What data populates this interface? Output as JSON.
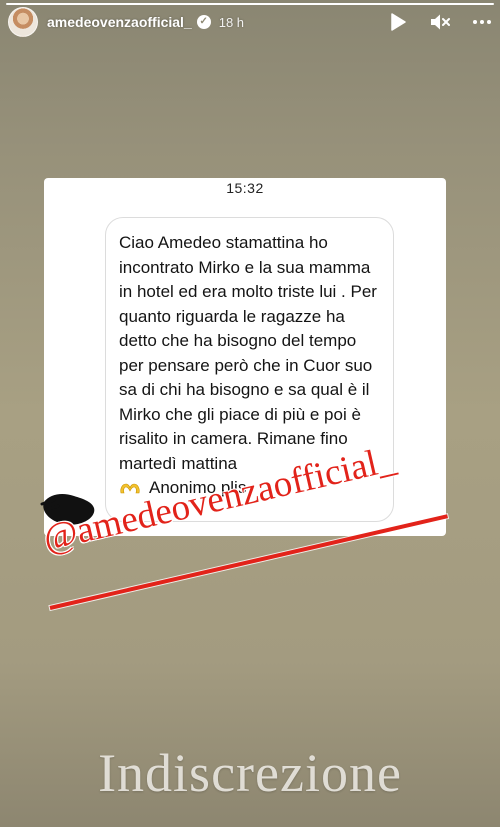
{
  "story": {
    "progress_fraction": 1.0,
    "username": "amedeovenzaofficial_",
    "time_ago": "18 h",
    "icons": [
      "avatar",
      "verified-badge-icon",
      "play-icon",
      "mute-icon",
      "more-icon"
    ]
  },
  "screenshot_card": {
    "time": "15:32",
    "message": "Ciao Amedeo stamattina ho incontrato Mirko e la sua mamma in hotel ed era molto triste lui . Per quanto riguarda le ragazze ha detto che ha bisogno del tempo per pensare però che in Cuor suo sa di chi ha bisogno e sa qual è il Mirko che gli piace di più e poi è risalito in camera. Rimane fino martedì mattina",
    "signature": "Anonimo plis",
    "signature_emoji": "heart-hands-emoji"
  },
  "mention_sticker": {
    "text": "@amedeovenzaofficial_",
    "color": "#e2231a"
  },
  "caption": {
    "text": "Indiscrezione"
  }
}
